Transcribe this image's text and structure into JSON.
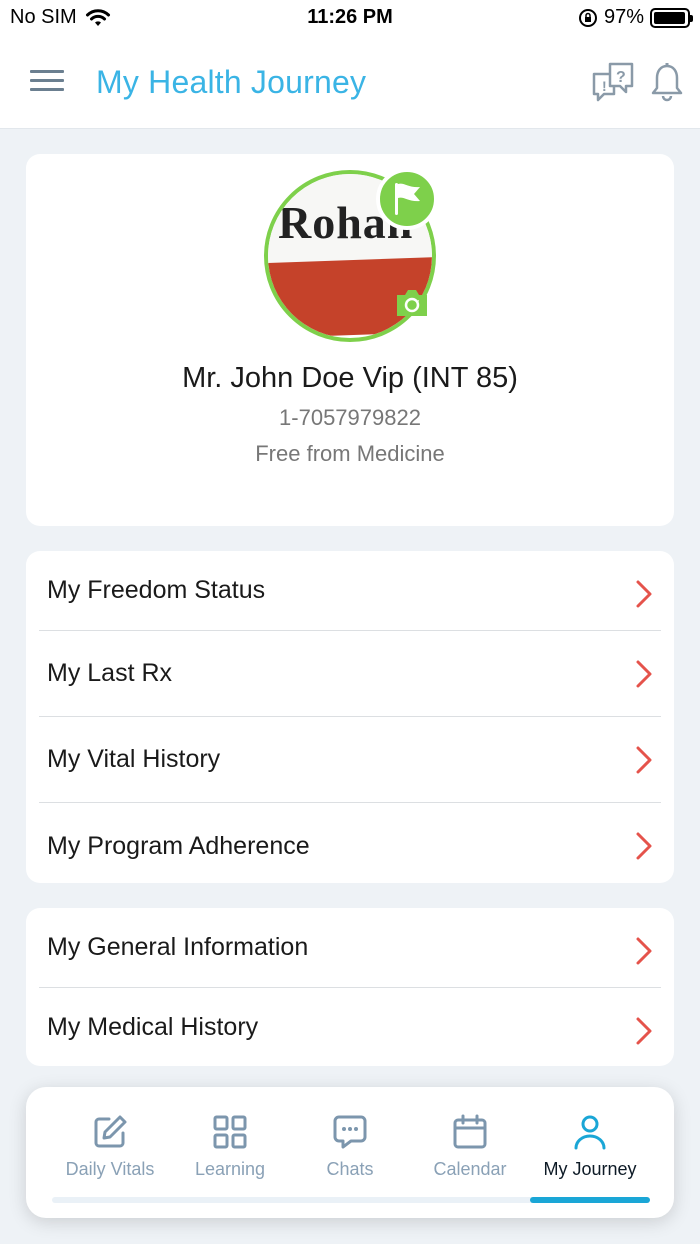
{
  "status_bar": {
    "carrier": "No SIM",
    "time": "11:26 PM",
    "battery_percent": "97%",
    "battery_level": 0.97
  },
  "app_bar": {
    "title": "My Health Journey",
    "menu_icon": "hamburger-menu-icon",
    "faq_icon": "faq-question-icon",
    "notification_icon": "bell-icon"
  },
  "profile": {
    "photo_text": "Rohan",
    "name": "Mr. John Doe Vip (INT 85)",
    "phone": "1-7057979822",
    "status": "Free from Medicine",
    "accent_color": "#7ed04b"
  },
  "menu_group_1": [
    {
      "label": "My Freedom Status"
    },
    {
      "label": "My Last Rx"
    },
    {
      "label": "My Vital History"
    },
    {
      "label": "My Program Adherence"
    }
  ],
  "menu_group_2": [
    {
      "label": "My General Information"
    },
    {
      "label": "My Medical History"
    }
  ],
  "tab_bar": {
    "tabs": [
      {
        "label": "Daily Vitals",
        "icon": "edit-icon"
      },
      {
        "label": "Learning",
        "icon": "grid-icon"
      },
      {
        "label": "Chats",
        "icon": "chat-bubble-icon"
      },
      {
        "label": "Calendar",
        "icon": "calendar-icon"
      },
      {
        "label": "My Journey",
        "icon": "user-icon",
        "active": true
      }
    ],
    "active_color": "#1aa6d6",
    "inactive_color": "#8aa1b6"
  },
  "colors": {
    "title": "#3ab4e5",
    "chevron": "#e5534b",
    "background": "#eef2f6"
  }
}
